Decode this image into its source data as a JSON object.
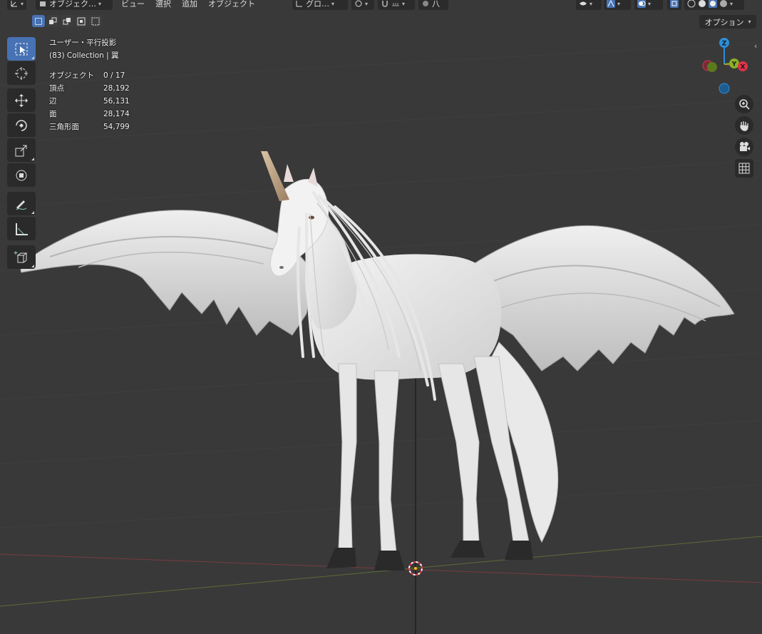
{
  "header": {
    "mode_label": "オブジェク…",
    "menus": [
      "ビュー",
      "選択",
      "追加",
      "オブジェクト"
    ],
    "transform_orientation": "グロ…",
    "snap_label": "八"
  },
  "options_label": "オプション",
  "overlay": {
    "view_name": "ユーザー・平行投影",
    "collection_line": "(83) Collection | 翼",
    "stats": [
      {
        "label": "オブジェクト",
        "value": "0 / 17"
      },
      {
        "label": "頂点",
        "value": "28,192"
      },
      {
        "label": "辺",
        "value": "56,131"
      },
      {
        "label": "面",
        "value": "28,174"
      },
      {
        "label": "三角形面",
        "value": "54,799"
      }
    ]
  },
  "gizmo": {
    "z_label": "Z",
    "y_label": "Y",
    "x_label": "X"
  },
  "colors": {
    "active_blue": "#4772b3",
    "axis_x": "#e0334a",
    "axis_y": "#8ab327",
    "axis_z": "#2c8fd9",
    "viewport_bg": "#393939"
  },
  "tools": [
    "select-box",
    "cursor",
    "move",
    "rotate",
    "scale",
    "transform",
    "annotate",
    "measure",
    "add-cube"
  ]
}
